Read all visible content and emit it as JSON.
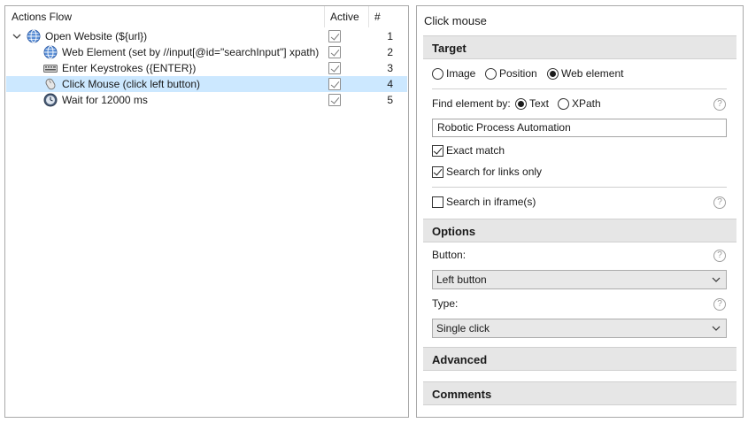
{
  "actions_flow": {
    "columns": {
      "name": "Actions Flow",
      "active": "Active",
      "number": "#"
    },
    "rows": [
      {
        "label": "Open Website (${url})",
        "number": "1",
        "icon": "globe-icon",
        "active": true,
        "expanded": true
      },
      {
        "label": "Web Element (set by //input[@id=\"searchInput\"] xpath)",
        "number": "2",
        "icon": "globe-icon",
        "active": true
      },
      {
        "label": "Enter Keystrokes ({ENTER})",
        "number": "3",
        "icon": "keyboard-icon",
        "active": true
      },
      {
        "label": "Click Mouse (click left button)",
        "number": "4",
        "icon": "mouse-icon",
        "active": true,
        "selected": true
      },
      {
        "label": "Wait for 12000 ms",
        "number": "5",
        "icon": "clock-icon",
        "active": true
      }
    ]
  },
  "properties": {
    "title": "Click mouse",
    "target": {
      "header": "Target",
      "target_options": [
        "Image",
        "Position",
        "Web element"
      ],
      "selected_target": "Web element",
      "find_label": "Find element by:",
      "find_options": [
        "Text",
        "XPath"
      ],
      "selected_find": "Text",
      "text_value": "Robotic Process Automation",
      "exact_match_label": "Exact match",
      "exact_match": true,
      "links_only_label": "Search for links only",
      "links_only": true,
      "iframe_label": "Search in iframe(s)",
      "iframe": false
    },
    "options": {
      "header": "Options",
      "button_label": "Button:",
      "button_value": "Left button",
      "type_label": "Type:",
      "type_value": "Single click"
    },
    "advanced_header": "Advanced",
    "comments_header": "Comments"
  },
  "colors": {
    "selection": "#cce8ff",
    "section_bg": "#e6e6e6",
    "border": "#a9a9a9"
  }
}
